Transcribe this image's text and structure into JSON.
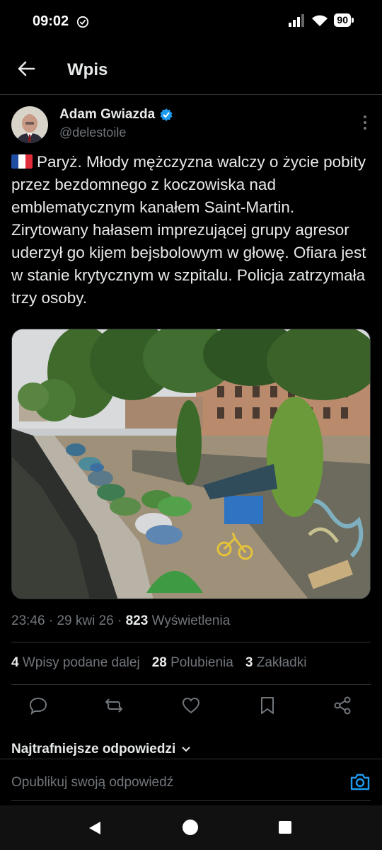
{
  "status_bar": {
    "time": "09:02",
    "battery": "90"
  },
  "header": {
    "title": "Wpis"
  },
  "author": {
    "name": "Adam Gwiazda",
    "handle": "@delestoile"
  },
  "tweet": {
    "text": "Paryż. Młody mężczyzna walczy o życie pobity przez bezdomnego z koczowiska nad emblematycznym  kanałem Saint-Martin. Zirytowany hałasem imprezującej grupy agresor uderzył go kijem bejsbolowym w głowę. Ofiara jest w stanie krytycznym w szpitalu. Policja zatrzymała trzy osoby."
  },
  "meta": {
    "time": "23:46",
    "date": "29 kwi 26",
    "views_count": "823",
    "views_label": "Wyświetlenia"
  },
  "stats": {
    "reposts_count": "4",
    "reposts_label": "Wpisy podane dalej",
    "likes_count": "28",
    "likes_label": "Polubienia",
    "bookmarks_count": "3",
    "bookmarks_label": "Zakładki"
  },
  "actions": [
    "reply-icon",
    "repost-icon",
    "like-icon",
    "bookmark-icon",
    "share-icon"
  ],
  "replies": {
    "sort_label": "Najtrafniejsze odpowiedzi"
  },
  "reply_bar": {
    "placeholder": "Opublikuj swoją odpowiedź"
  },
  "colors": {
    "accent": "#1d9bf0",
    "muted": "#71767b",
    "text": "#e7e9ea",
    "border": "#2f3336"
  }
}
